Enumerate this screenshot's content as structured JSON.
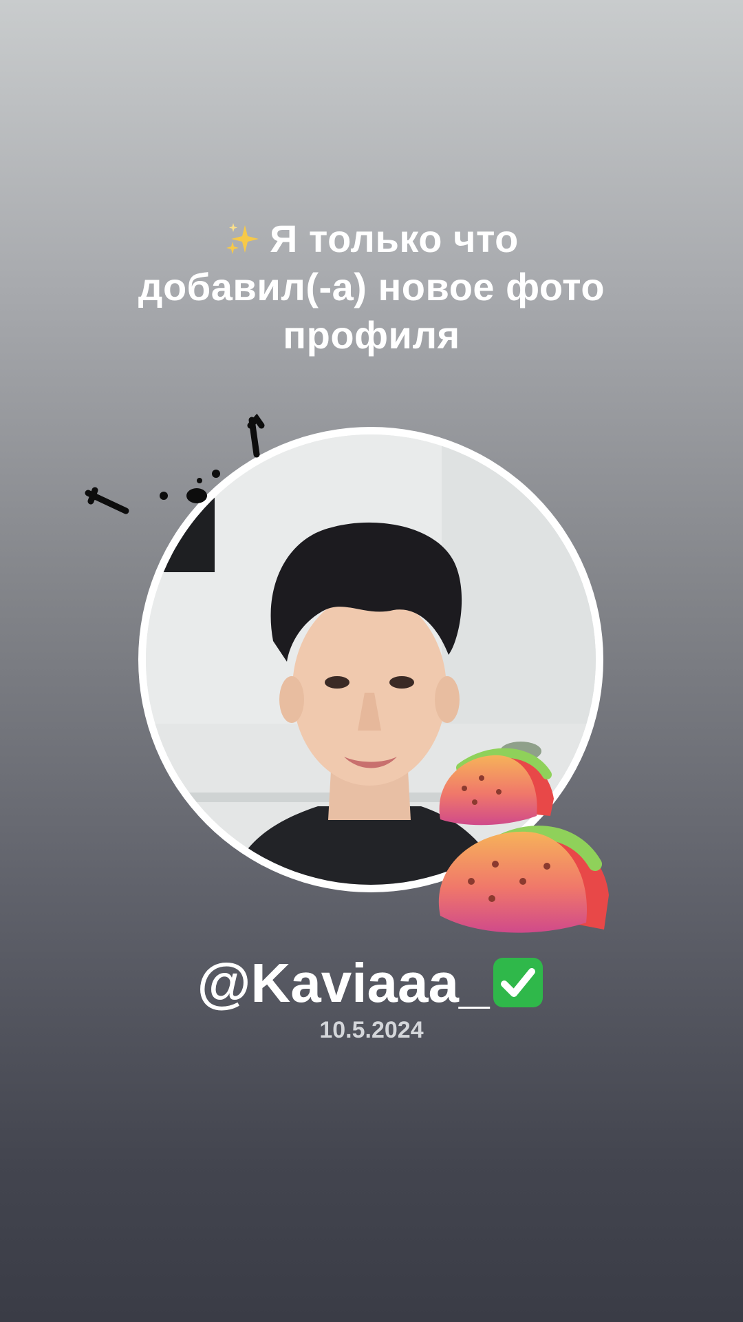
{
  "headline": {
    "line1": "Я только что",
    "line2": "добавил(-а) новое фото",
    "line3": "профиля",
    "emoji": "sparkles-icon"
  },
  "profile": {
    "username": "@Kaviaaa_",
    "verified_emoji": "check-mark-button-icon",
    "date": "10.5.2024"
  },
  "stickers": [
    "taco-icon",
    "taco-icon",
    "doodle-drawing"
  ],
  "colors": {
    "text": "#ffffff",
    "date_text": "#d4d6da",
    "ring": "#ffffff",
    "check_green": "#2fb84a"
  }
}
